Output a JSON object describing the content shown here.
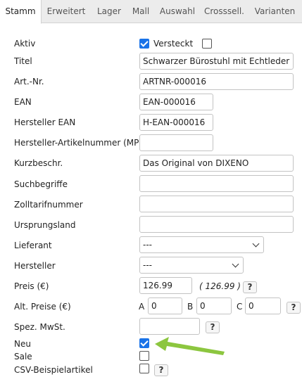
{
  "tabs": [
    "Stamm",
    "Erweitert",
    "Lager",
    "Mall",
    "Auswahl",
    "Crosssell.",
    "Varianten"
  ],
  "fields": {
    "aktiv": {
      "label": "Aktiv",
      "versteckt_label": "Versteckt",
      "aktiv_checked": true,
      "versteckt_checked": false
    },
    "titel": {
      "label": "Titel",
      "value": "Schwarzer Bürostuhl mit Echtleder"
    },
    "artnr": {
      "label": "Art.-Nr.",
      "value": "ARTNR-000016"
    },
    "ean": {
      "label": "EAN",
      "value": "EAN-000016"
    },
    "hersteller_ean": {
      "label": "Hersteller EAN",
      "value": "H-EAN-000016"
    },
    "mpn": {
      "label": "Hersteller-Artikelnummer (MPN)",
      "value": ""
    },
    "kurzbeschr": {
      "label": "Kurzbeschr.",
      "value": "Das Original von DIXENO"
    },
    "suchbegriffe": {
      "label": "Suchbegriffe",
      "value": ""
    },
    "zolltarif": {
      "label": "Zolltarifnummer",
      "value": ""
    },
    "ursprungsland": {
      "label": "Ursprungsland",
      "value": ""
    },
    "lieferant": {
      "label": "Lieferant",
      "value": "---"
    },
    "hersteller": {
      "label": "Hersteller",
      "value": "---"
    },
    "preis": {
      "label": "Preis (€)",
      "value": "126.99",
      "computed": "( 126.99 )"
    },
    "alt_preise": {
      "label": "Alt. Preise (€)",
      "a_label": "A",
      "a_value": "0",
      "b_label": "B",
      "b_value": "0",
      "c_label": "C",
      "c_value": "0"
    },
    "spez_mwst": {
      "label": "Spez. MwSt.",
      "value": ""
    },
    "neu": {
      "label": "Neu",
      "checked": true
    },
    "sale": {
      "label": "Sale",
      "checked": false
    },
    "csv": {
      "label": "CSV-Beispielartikel",
      "checked": false
    }
  },
  "help_label": "?",
  "colors": {
    "accent": "#1a73e8",
    "arrow": "#8cc63f"
  }
}
